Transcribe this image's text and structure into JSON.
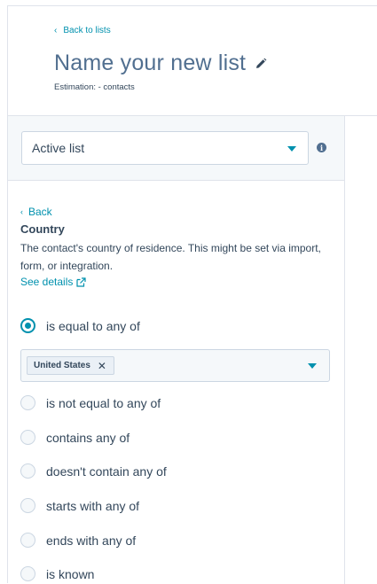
{
  "header": {
    "back_label": "Back to lists",
    "title": "Name your new list",
    "estimation": "Estimation: - contacts"
  },
  "list_type": {
    "selected": "Active list"
  },
  "filter": {
    "back_label": "Back",
    "property_name": "Country",
    "description": "The contact's country of residence. This might be set via import, form, or integration.",
    "see_details": "See details",
    "selected_values": [
      "United States"
    ],
    "options": [
      {
        "label": "is equal to any of",
        "checked": true
      },
      {
        "label": "is not equal to any of",
        "checked": false
      },
      {
        "label": "contains any of",
        "checked": false
      },
      {
        "label": "doesn't contain any of",
        "checked": false
      },
      {
        "label": "starts with any of",
        "checked": false
      },
      {
        "label": "ends with any of",
        "checked": false
      },
      {
        "label": "is known",
        "checked": false
      }
    ]
  },
  "colors": {
    "accent": "#0091ae",
    "text": "#33475b",
    "border": "#cbd6e2",
    "panel_bg": "#f5f8fa"
  }
}
